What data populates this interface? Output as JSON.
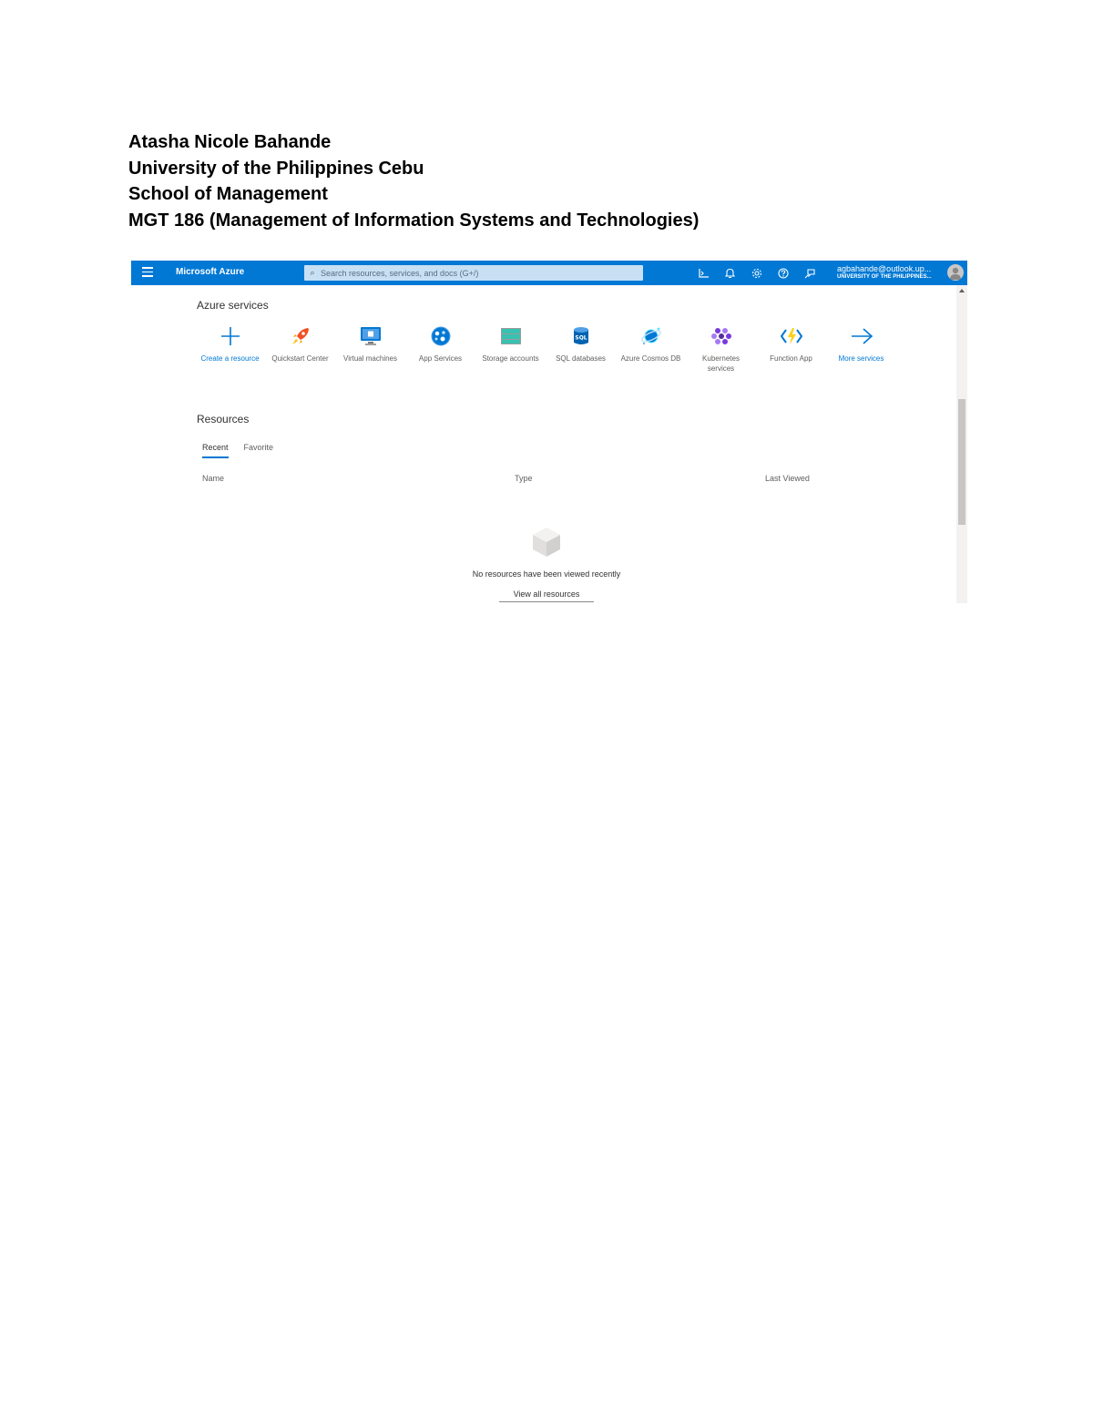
{
  "document": {
    "lines": [
      "Atasha Nicole Bahande",
      "University of the Philippines Cebu",
      "School of Management",
      "MGT 186 (Management of Information Systems and Technologies)"
    ]
  },
  "portal": {
    "brand": "Microsoft Azure",
    "search_placeholder": "Search resources, services, and docs (G+/)",
    "account_email": "agbahande@outlook.up...",
    "account_org": "UNIVERSITY OF THE PHILIPPINES...",
    "toolbar_icons": [
      "cloud-shell-icon",
      "notifications-icon",
      "settings-icon",
      "help-icon",
      "feedback-icon"
    ],
    "services_title": "Azure services",
    "services": [
      {
        "label": "Create a resource",
        "icon": "plus-icon"
      },
      {
        "label": "Quickstart Center",
        "icon": "rocket-icon"
      },
      {
        "label": "Virtual machines",
        "icon": "monitor-icon"
      },
      {
        "label": "App Services",
        "icon": "globe-icon"
      },
      {
        "label": "Storage accounts",
        "icon": "storage-icon"
      },
      {
        "label": "SQL databases",
        "icon": "sql-icon"
      },
      {
        "label": "Azure Cosmos DB",
        "icon": "cosmos-icon"
      },
      {
        "label": "Kubernetes services",
        "icon": "kubernetes-icon"
      },
      {
        "label": "Function App",
        "icon": "function-icon"
      },
      {
        "label": "More services",
        "icon": "arrow-right-icon"
      }
    ],
    "resources_title": "Resources",
    "tabs": [
      "Recent",
      "Favorite"
    ],
    "columns": [
      "Name",
      "Type",
      "Last Viewed"
    ],
    "empty_message": "No resources have been viewed recently",
    "view_all_label": "View all resources",
    "colors": {
      "accent": "#0078d4",
      "search_bg": "#c7e0f4"
    }
  }
}
